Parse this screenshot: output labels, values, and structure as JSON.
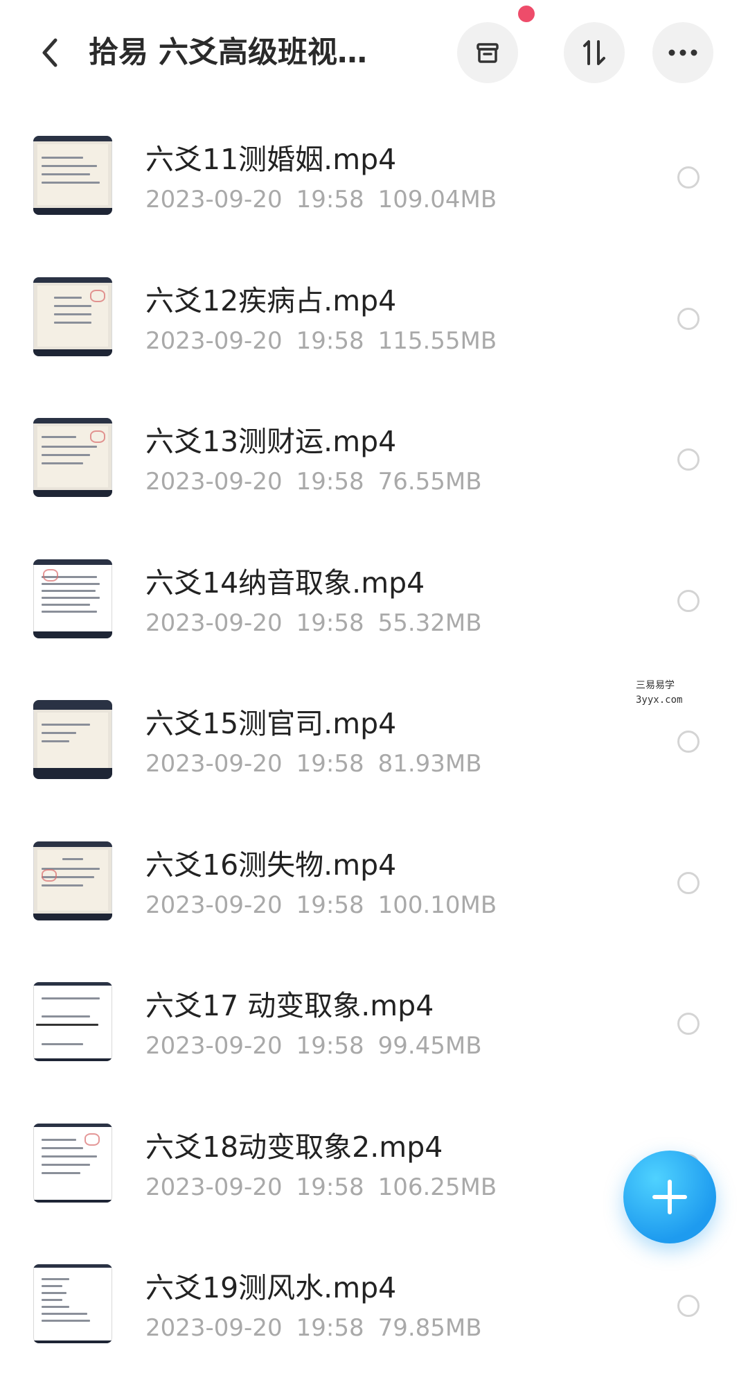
{
  "header": {
    "title": "拾易 六爻高级班视…",
    "back_icon": "chevron-left-icon",
    "actions": [
      {
        "name": "archive",
        "icon": "archive-icon"
      },
      {
        "name": "sort",
        "icon": "sort-icon"
      },
      {
        "name": "more",
        "icon": "more-horizontal-icon"
      }
    ],
    "notification_dot_color": "#ee4c6a"
  },
  "files": [
    {
      "name": "六爻11测婚姻.mp4",
      "date": "2023-09-20",
      "time": "19:58",
      "size": "109.04MB"
    },
    {
      "name": "六爻12疾病占.mp4",
      "date": "2023-09-20",
      "time": "19:58",
      "size": "115.55MB"
    },
    {
      "name": "六爻13测财运.mp4",
      "date": "2023-09-20",
      "time": "19:58",
      "size": "76.55MB"
    },
    {
      "name": "六爻14纳音取象.mp4",
      "date": "2023-09-20",
      "time": "19:58",
      "size": "55.32MB"
    },
    {
      "name": "六爻15测官司.mp4",
      "date": "2023-09-20",
      "time": "19:58",
      "size": "81.93MB"
    },
    {
      "name": "六爻16测失物.mp4",
      "date": "2023-09-20",
      "time": "19:58",
      "size": "100.10MB"
    },
    {
      "name": "六爻17 动变取象.mp4",
      "date": "2023-09-20",
      "time": "19:58",
      "size": "99.45MB"
    },
    {
      "name": "六爻18动变取象2.mp4",
      "date": "2023-09-20",
      "time": "19:58",
      "size": "106.25MB"
    },
    {
      "name": "六爻19测风水.mp4",
      "date": "2023-09-20",
      "time": "19:58",
      "size": "79.85MB"
    }
  ],
  "watermark": {
    "line1": "三易易学",
    "line2": "3yyx.com"
  },
  "fab": {
    "icon": "plus-icon",
    "color": "#1e9bef"
  }
}
